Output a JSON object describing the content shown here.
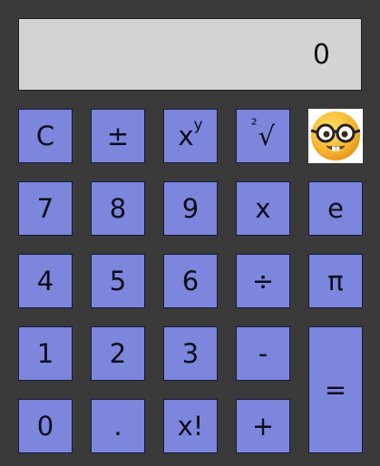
{
  "display": {
    "value": "0"
  },
  "keys": {
    "clear": "C",
    "plus_minus": "±",
    "power_base": "x",
    "power_exp": "y",
    "root_index": "²",
    "root_symbol": "√",
    "seven": "7",
    "eight": "8",
    "nine": "9",
    "multiply": "x",
    "e": "e",
    "four": "4",
    "five": "5",
    "six": "6",
    "divide": "÷",
    "pi": "π",
    "one": "1",
    "two": "2",
    "three": "3",
    "minus": "-",
    "equals": "=",
    "zero": "0",
    "decimal": ".",
    "factorial": "x!",
    "plus": "+"
  },
  "icons": {
    "mode_emoji": "nerd-face-icon"
  },
  "colors": {
    "background": "#3a3a3a",
    "display": "#d3d3d3",
    "key": "#7b86dc",
    "emoji_yellow": "#f7b733"
  }
}
